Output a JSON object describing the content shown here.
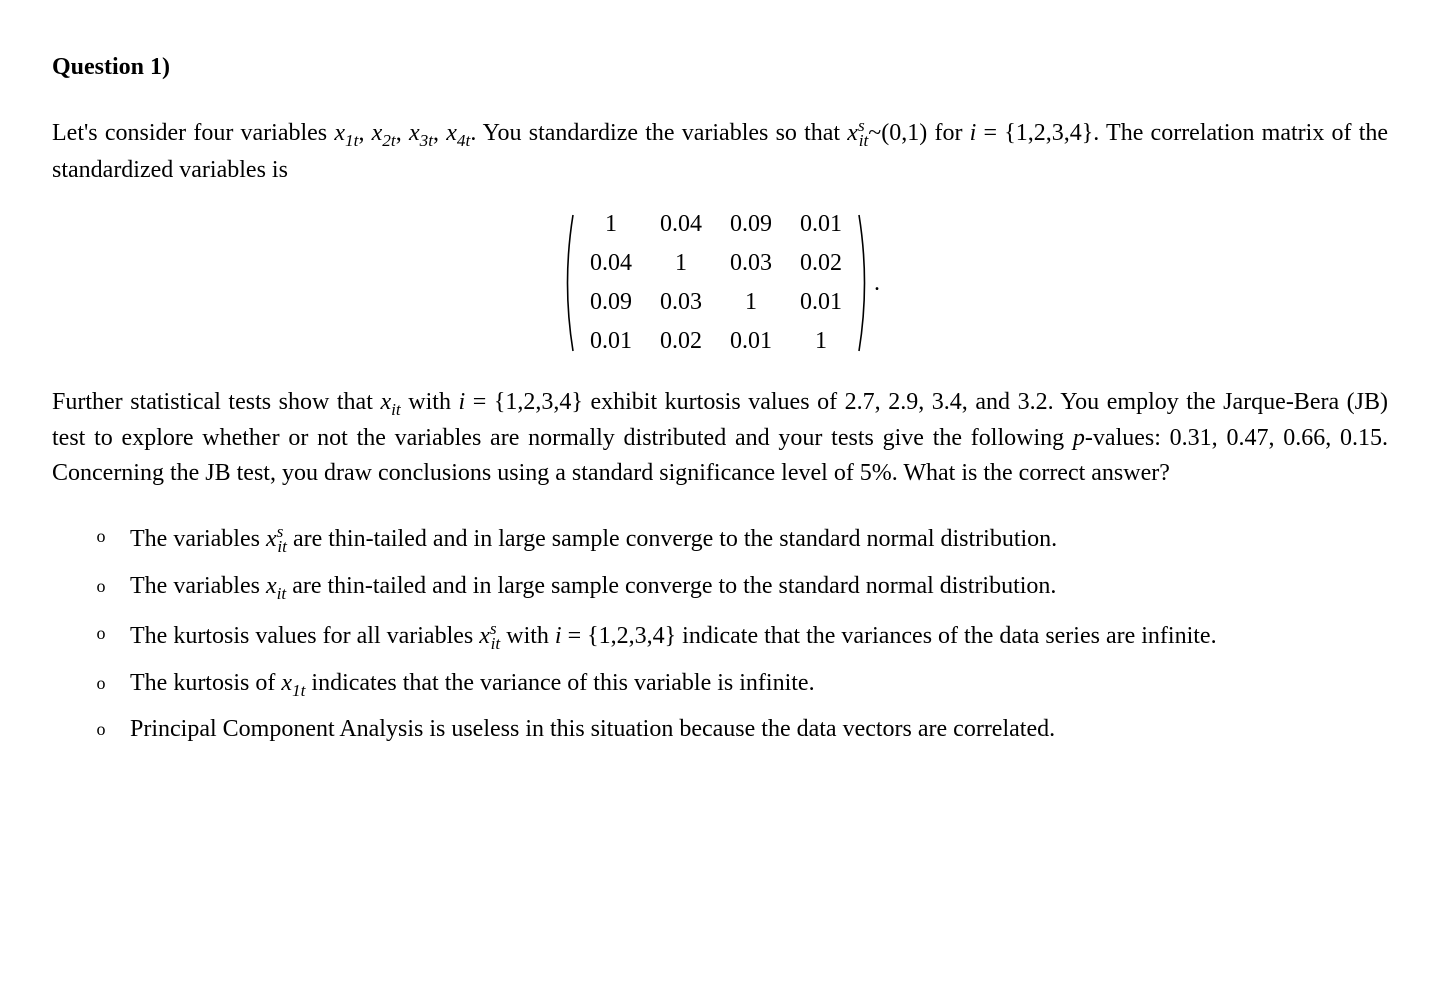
{
  "heading": "Question 1)",
  "para1_pre": "Let's consider four variables ",
  "vars": {
    "x1": "x",
    "x1sub": "1t",
    "x2": "x",
    "x2sub": "2t",
    "x3": "x",
    "x3sub": "3t",
    "x4": "x",
    "x4sub": "4t"
  },
  "para1_mid": ". You standardize the variables so that ",
  "xs_var": "x",
  "xs_sub": "it",
  "xs_sup": "s",
  "para1_mid2": "~(0,1) for ",
  "i_eq": "i",
  "i_set": " = {1,2,3,4}. The correlation matrix of the standardized variables is",
  "matrix": [
    [
      "1",
      "0.04",
      "0.09",
      "0.01"
    ],
    [
      "0.04",
      "1",
      "0.03",
      "0.02"
    ],
    [
      "0.09",
      "0.03",
      "1",
      "0.01"
    ],
    [
      "0.01",
      "0.02",
      "0.01",
      "1"
    ]
  ],
  "matrix_end": ".",
  "para2_a": "Further statistical tests show that ",
  "para2_var": "x",
  "para2_sub": "it",
  "para2_b": "  with ",
  "para2_i": "i",
  "para2_c": " = {1,2,3,4} exhibit kurtosis values of 2.7, 2.9, 3.4, and 3.2. You employ the Jarque-Bera (JB) test to explore whether or not the variables are normally distributed and your tests give the following ",
  "para2_p": "p",
  "para2_d": "-values: 0.31, 0.47, 0.66, 0.15. Concerning the JB test, you draw conclusions using a standard significance level of 5%. What is the correct answer?",
  "options": [
    {
      "sym": "o",
      "pre": "The variables ",
      "var": "x",
      "sub": "it",
      "sup": "s",
      "post": " are thin-tailed and in large sample converge to the standard normal distribution."
    },
    {
      "sym": "o",
      "pre": "The variables ",
      "var": "x",
      "sub": "it",
      "sup": "",
      "post": " are thin-tailed and in large sample converge to the standard normal distribution."
    },
    {
      "sym": "o",
      "pre": "The kurtosis values for all variables ",
      "var": "x",
      "sub": "it",
      "sup": "s",
      "mid": " with ",
      "ivar": "i",
      "post": " = {1,2,3,4} indicate that the variances of the data series are infinite."
    },
    {
      "sym": "o",
      "pre": "The kurtosis of ",
      "var": "x",
      "sub": "1t",
      "sup": "",
      "post": " indicates that the variance of this variable is infinite."
    },
    {
      "sym": "o",
      "pre": "Principal Component Analysis is useless in this situation because the data vectors are correlated.",
      "var": "",
      "sub": "",
      "sup": "",
      "post": ""
    }
  ]
}
